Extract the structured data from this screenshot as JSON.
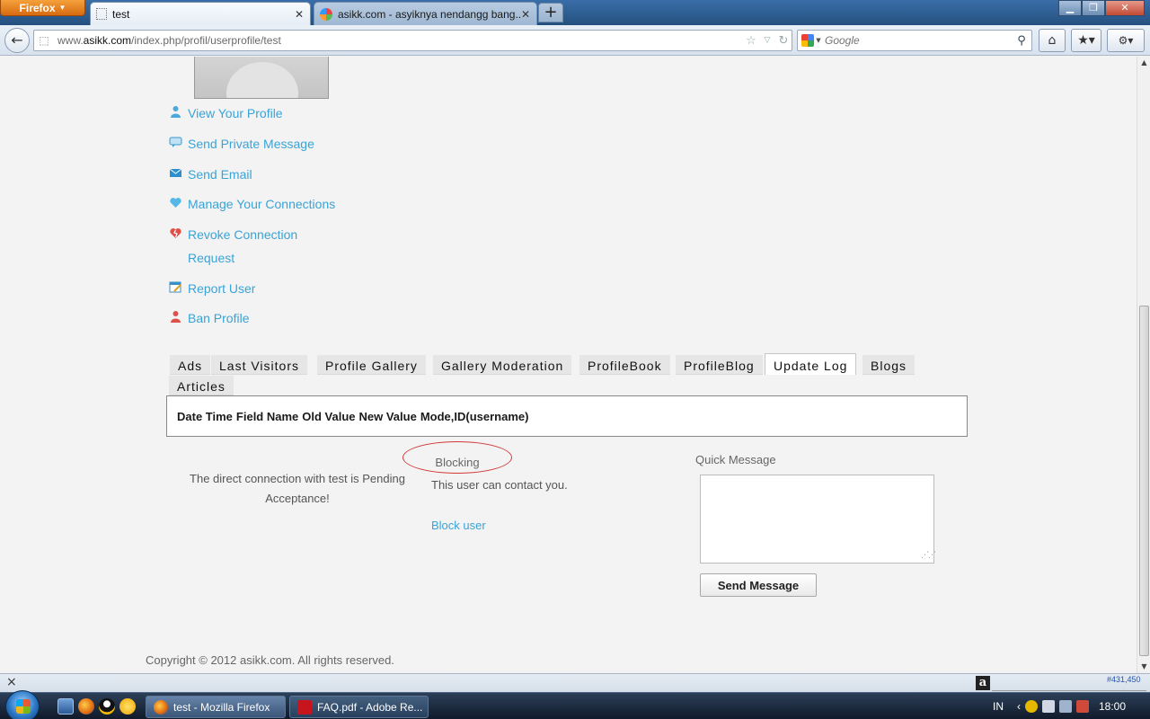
{
  "browser": {
    "app_button": "Firefox",
    "tabs": [
      {
        "label": "test"
      },
      {
        "label": "asikk.com - asyiknya nendangg bang..."
      }
    ],
    "new_tab": "+",
    "url_prefix": "www.",
    "url_host": "asikk.com",
    "url_path": "/index.php/profil/userprofile/test",
    "search_placeholder": "Google"
  },
  "profile_menu": [
    {
      "label": "View Your Profile",
      "icon": "user-icon"
    },
    {
      "label": "Send Private Message",
      "icon": "speech-bubble-icon"
    },
    {
      "label": "Send Email",
      "icon": "envelope-icon"
    },
    {
      "label": "Manage Your Connections",
      "icon": "heart-icon"
    },
    {
      "label": "Revoke Connection Request",
      "line1": "Revoke Connection",
      "line2": "Request",
      "icon": "broken-heart-icon"
    },
    {
      "label": "Report User",
      "icon": "report-icon"
    },
    {
      "label": "Ban Profile",
      "icon": "ban-user-icon"
    }
  ],
  "profile_tabs": [
    {
      "label": "Ads",
      "active": false
    },
    {
      "label": "Last Visitors",
      "active": false
    },
    {
      "label": "Profile Gallery",
      "active": false
    },
    {
      "label": "Gallery Moderation",
      "active": false
    },
    {
      "label": "ProfileBook",
      "active": false
    },
    {
      "label": "ProfileBlog",
      "active": false
    },
    {
      "label": "Update Log",
      "active": true
    },
    {
      "label": "Blogs",
      "active": false
    },
    {
      "label": "Articles",
      "active": false
    }
  ],
  "update_log": {
    "headers": [
      "Date Time",
      "Field Name",
      "Old Value",
      "New Value",
      "Mode,ID(username)"
    ]
  },
  "connection": {
    "status_line1": "The direct connection with test is Pending",
    "status_line2": "Acceptance!"
  },
  "blocking": {
    "title": "Blocking",
    "text": "This user can contact you.",
    "link": "Block user"
  },
  "quick_message": {
    "title": "Quick Message",
    "value": "",
    "send_label": "Send Message"
  },
  "footer": {
    "copyright": "Copyright © 2012 asikk.com. All rights reserved."
  },
  "statusbar": {
    "close": "×",
    "alexa_letter": "a",
    "alexa_rank": "#431,450"
  },
  "taskbar": {
    "tasks": [
      {
        "label": "test - Mozilla Firefox"
      },
      {
        "label": "FAQ.pdf - Adobe Re..."
      }
    ],
    "lang": "IN",
    "clock": "18:00"
  },
  "colors": {
    "link": "#3aa3d6",
    "active_tab_bg": "#ffffff",
    "tab_bg": "#e6e6e6",
    "blocking_ellipse": "#d23a3a"
  }
}
